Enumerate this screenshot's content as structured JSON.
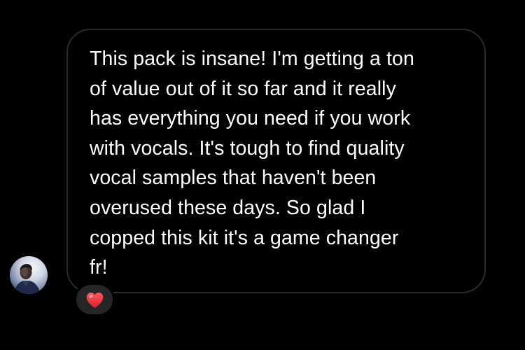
{
  "message": {
    "text": "This pack is insane! I'm getting a ton\nof value out of it so far and it really\nhas everything you need if you work\nwith vocals. It's tough to find quality\nvocal samples that haven't been\noverused these days. So glad I\ncopped this kit it's a game changer\nfr!"
  },
  "sender": {
    "avatar_icon": "person-avatar"
  },
  "reaction": {
    "emoji_icon": "red-heart-icon",
    "color": "#e2323a"
  },
  "theme": {
    "background": "#000000",
    "bubble_border": "#2b2b2e",
    "text": "#ffffff",
    "reaction_pill": "#262629"
  }
}
